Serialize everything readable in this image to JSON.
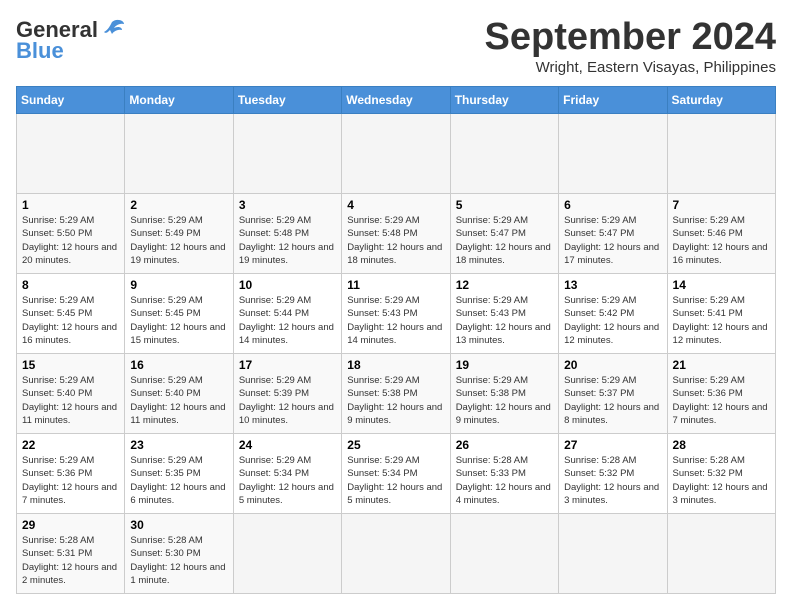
{
  "header": {
    "logo_general": "General",
    "logo_blue": "Blue",
    "month_title": "September 2024",
    "location": "Wright, Eastern Visayas, Philippines"
  },
  "calendar": {
    "days_of_week": [
      "Sunday",
      "Monday",
      "Tuesday",
      "Wednesday",
      "Thursday",
      "Friday",
      "Saturday"
    ],
    "weeks": [
      [
        {
          "date": "",
          "empty": true
        },
        {
          "date": "",
          "empty": true
        },
        {
          "date": "",
          "empty": true
        },
        {
          "date": "",
          "empty": true
        },
        {
          "date": "",
          "empty": true
        },
        {
          "date": "",
          "empty": true
        },
        {
          "date": "",
          "empty": true
        }
      ],
      [
        {
          "date": "1",
          "sunrise": "Sunrise: 5:29 AM",
          "sunset": "Sunset: 5:50 PM",
          "daylight": "Daylight: 12 hours and 20 minutes."
        },
        {
          "date": "2",
          "sunrise": "Sunrise: 5:29 AM",
          "sunset": "Sunset: 5:49 PM",
          "daylight": "Daylight: 12 hours and 19 minutes."
        },
        {
          "date": "3",
          "sunrise": "Sunrise: 5:29 AM",
          "sunset": "Sunset: 5:48 PM",
          "daylight": "Daylight: 12 hours and 19 minutes."
        },
        {
          "date": "4",
          "sunrise": "Sunrise: 5:29 AM",
          "sunset": "Sunset: 5:48 PM",
          "daylight": "Daylight: 12 hours and 18 minutes."
        },
        {
          "date": "5",
          "sunrise": "Sunrise: 5:29 AM",
          "sunset": "Sunset: 5:47 PM",
          "daylight": "Daylight: 12 hours and 18 minutes."
        },
        {
          "date": "6",
          "sunrise": "Sunrise: 5:29 AM",
          "sunset": "Sunset: 5:47 PM",
          "daylight": "Daylight: 12 hours and 17 minutes."
        },
        {
          "date": "7",
          "sunrise": "Sunrise: 5:29 AM",
          "sunset": "Sunset: 5:46 PM",
          "daylight": "Daylight: 12 hours and 16 minutes."
        }
      ],
      [
        {
          "date": "8",
          "sunrise": "Sunrise: 5:29 AM",
          "sunset": "Sunset: 5:45 PM",
          "daylight": "Daylight: 12 hours and 16 minutes."
        },
        {
          "date": "9",
          "sunrise": "Sunrise: 5:29 AM",
          "sunset": "Sunset: 5:45 PM",
          "daylight": "Daylight: 12 hours and 15 minutes."
        },
        {
          "date": "10",
          "sunrise": "Sunrise: 5:29 AM",
          "sunset": "Sunset: 5:44 PM",
          "daylight": "Daylight: 12 hours and 14 minutes."
        },
        {
          "date": "11",
          "sunrise": "Sunrise: 5:29 AM",
          "sunset": "Sunset: 5:43 PM",
          "daylight": "Daylight: 12 hours and 14 minutes."
        },
        {
          "date": "12",
          "sunrise": "Sunrise: 5:29 AM",
          "sunset": "Sunset: 5:43 PM",
          "daylight": "Daylight: 12 hours and 13 minutes."
        },
        {
          "date": "13",
          "sunrise": "Sunrise: 5:29 AM",
          "sunset": "Sunset: 5:42 PM",
          "daylight": "Daylight: 12 hours and 12 minutes."
        },
        {
          "date": "14",
          "sunrise": "Sunrise: 5:29 AM",
          "sunset": "Sunset: 5:41 PM",
          "daylight": "Daylight: 12 hours and 12 minutes."
        }
      ],
      [
        {
          "date": "15",
          "sunrise": "Sunrise: 5:29 AM",
          "sunset": "Sunset: 5:40 PM",
          "daylight": "Daylight: 12 hours and 11 minutes."
        },
        {
          "date": "16",
          "sunrise": "Sunrise: 5:29 AM",
          "sunset": "Sunset: 5:40 PM",
          "daylight": "Daylight: 12 hours and 11 minutes."
        },
        {
          "date": "17",
          "sunrise": "Sunrise: 5:29 AM",
          "sunset": "Sunset: 5:39 PM",
          "daylight": "Daylight: 12 hours and 10 minutes."
        },
        {
          "date": "18",
          "sunrise": "Sunrise: 5:29 AM",
          "sunset": "Sunset: 5:38 PM",
          "daylight": "Daylight: 12 hours and 9 minutes."
        },
        {
          "date": "19",
          "sunrise": "Sunrise: 5:29 AM",
          "sunset": "Sunset: 5:38 PM",
          "daylight": "Daylight: 12 hours and 9 minutes."
        },
        {
          "date": "20",
          "sunrise": "Sunrise: 5:29 AM",
          "sunset": "Sunset: 5:37 PM",
          "daylight": "Daylight: 12 hours and 8 minutes."
        },
        {
          "date": "21",
          "sunrise": "Sunrise: 5:29 AM",
          "sunset": "Sunset: 5:36 PM",
          "daylight": "Daylight: 12 hours and 7 minutes."
        }
      ],
      [
        {
          "date": "22",
          "sunrise": "Sunrise: 5:29 AM",
          "sunset": "Sunset: 5:36 PM",
          "daylight": "Daylight: 12 hours and 7 minutes."
        },
        {
          "date": "23",
          "sunrise": "Sunrise: 5:29 AM",
          "sunset": "Sunset: 5:35 PM",
          "daylight": "Daylight: 12 hours and 6 minutes."
        },
        {
          "date": "24",
          "sunrise": "Sunrise: 5:29 AM",
          "sunset": "Sunset: 5:34 PM",
          "daylight": "Daylight: 12 hours and 5 minutes."
        },
        {
          "date": "25",
          "sunrise": "Sunrise: 5:29 AM",
          "sunset": "Sunset: 5:34 PM",
          "daylight": "Daylight: 12 hours and 5 minutes."
        },
        {
          "date": "26",
          "sunrise": "Sunrise: 5:28 AM",
          "sunset": "Sunset: 5:33 PM",
          "daylight": "Daylight: 12 hours and 4 minutes."
        },
        {
          "date": "27",
          "sunrise": "Sunrise: 5:28 AM",
          "sunset": "Sunset: 5:32 PM",
          "daylight": "Daylight: 12 hours and 3 minutes."
        },
        {
          "date": "28",
          "sunrise": "Sunrise: 5:28 AM",
          "sunset": "Sunset: 5:32 PM",
          "daylight": "Daylight: 12 hours and 3 minutes."
        }
      ],
      [
        {
          "date": "29",
          "sunrise": "Sunrise: 5:28 AM",
          "sunset": "Sunset: 5:31 PM",
          "daylight": "Daylight: 12 hours and 2 minutes."
        },
        {
          "date": "30",
          "sunrise": "Sunrise: 5:28 AM",
          "sunset": "Sunset: 5:30 PM",
          "daylight": "Daylight: 12 hours and 1 minute."
        },
        {
          "date": "",
          "empty": true
        },
        {
          "date": "",
          "empty": true
        },
        {
          "date": "",
          "empty": true
        },
        {
          "date": "",
          "empty": true
        },
        {
          "date": "",
          "empty": true
        }
      ]
    ]
  }
}
